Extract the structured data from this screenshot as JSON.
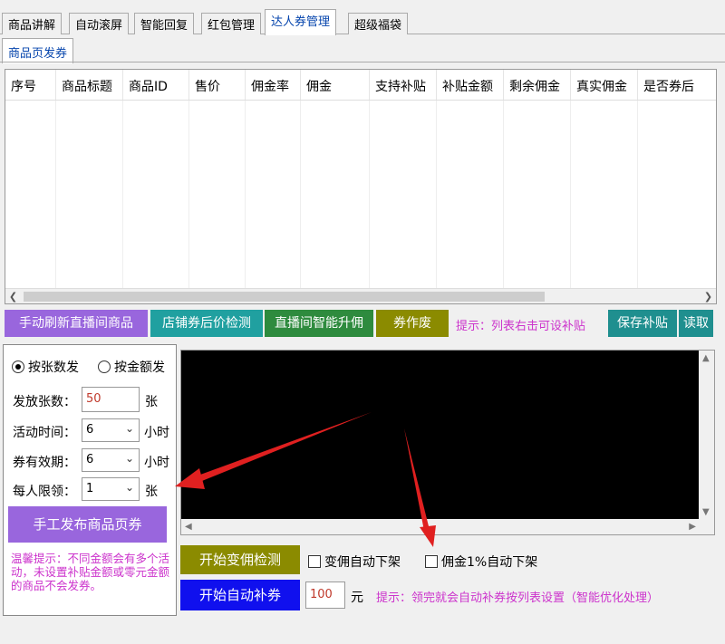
{
  "tabs": [
    "商品讲解",
    "自动滚屏",
    "智能回复",
    "红包管理",
    "达人券管理",
    "超级福袋"
  ],
  "subtab": "商品页发券",
  "table": {
    "columns": [
      "序号",
      "商品标题",
      "商品ID",
      "售价",
      "佣金率",
      "佣金",
      "支持补贴",
      "补贴金额",
      "剩余佣金",
      "真实佣金",
      "是否券后"
    ]
  },
  "buttons": {
    "refresh": "手动刷新直播间商品",
    "store_check": "店铺券后价检测",
    "smart_raise": "直播间智能升佣",
    "void": "券作废",
    "save_subsidy": "保存补贴",
    "read": "读取",
    "manual_issue": "手工发布商品页券",
    "start_change_check": "开始变佣检测",
    "start_auto_subsidy": "开始自动补券"
  },
  "tips": {
    "table_tip": "提示：列表右击可设补贴",
    "warm": "温馨提示：不同金额会有多个活动，未设置补贴金额或零元金额的商品不会发券。",
    "bottom": "提示：领完就会自动补券按列表设置（智能优化处理）"
  },
  "form": {
    "radio_by_count": "按张数发",
    "radio_by_amount": "按金额发",
    "count_label": "发放张数：",
    "count_value": "50",
    "count_unit": "张",
    "activity_label": "活动时间：",
    "activity_value": "6",
    "activity_unit": "小时",
    "validity_label": "券有效期：",
    "validity_value": "6",
    "validity_unit": "小时",
    "limit_label": "每人限领：",
    "limit_value": "1",
    "limit_unit": "张"
  },
  "checks": {
    "change_off": "变佣自动下架",
    "commission_off": "佣金1%自动下架"
  },
  "amount": {
    "value": "100",
    "unit": "元"
  },
  "colors": {
    "btn_purple": "#9966dd",
    "btn_teal": "#20a0a0",
    "btn_green": "#2e8b3e",
    "btn_olive": "#8b8b00",
    "btn_blue": "#1010ee",
    "btn_dark_teal": "#1f8f8f",
    "tip_magenta": "#cc33cc",
    "arrow_red": "#e02020"
  }
}
